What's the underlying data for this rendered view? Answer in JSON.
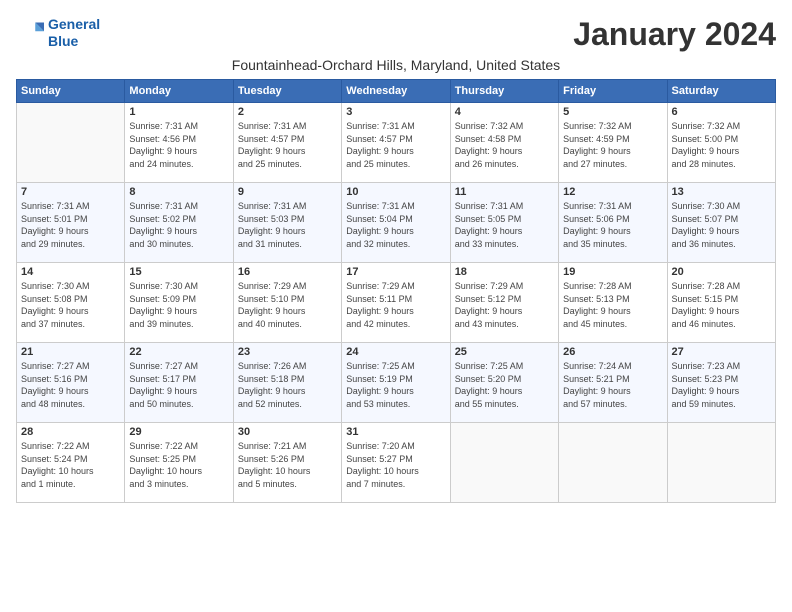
{
  "logo": {
    "line1": "General",
    "line2": "Blue"
  },
  "title": "January 2024",
  "location": "Fountainhead-Orchard Hills, Maryland, United States",
  "days_of_week": [
    "Sunday",
    "Monday",
    "Tuesday",
    "Wednesday",
    "Thursday",
    "Friday",
    "Saturday"
  ],
  "weeks": [
    [
      {
        "day": "",
        "info": ""
      },
      {
        "day": "1",
        "info": "Sunrise: 7:31 AM\nSunset: 4:56 PM\nDaylight: 9 hours\nand 24 minutes."
      },
      {
        "day": "2",
        "info": "Sunrise: 7:31 AM\nSunset: 4:57 PM\nDaylight: 9 hours\nand 25 minutes."
      },
      {
        "day": "3",
        "info": "Sunrise: 7:31 AM\nSunset: 4:57 PM\nDaylight: 9 hours\nand 25 minutes."
      },
      {
        "day": "4",
        "info": "Sunrise: 7:32 AM\nSunset: 4:58 PM\nDaylight: 9 hours\nand 26 minutes."
      },
      {
        "day": "5",
        "info": "Sunrise: 7:32 AM\nSunset: 4:59 PM\nDaylight: 9 hours\nand 27 minutes."
      },
      {
        "day": "6",
        "info": "Sunrise: 7:32 AM\nSunset: 5:00 PM\nDaylight: 9 hours\nand 28 minutes."
      }
    ],
    [
      {
        "day": "7",
        "info": "Sunrise: 7:31 AM\nSunset: 5:01 PM\nDaylight: 9 hours\nand 29 minutes."
      },
      {
        "day": "8",
        "info": "Sunrise: 7:31 AM\nSunset: 5:02 PM\nDaylight: 9 hours\nand 30 minutes."
      },
      {
        "day": "9",
        "info": "Sunrise: 7:31 AM\nSunset: 5:03 PM\nDaylight: 9 hours\nand 31 minutes."
      },
      {
        "day": "10",
        "info": "Sunrise: 7:31 AM\nSunset: 5:04 PM\nDaylight: 9 hours\nand 32 minutes."
      },
      {
        "day": "11",
        "info": "Sunrise: 7:31 AM\nSunset: 5:05 PM\nDaylight: 9 hours\nand 33 minutes."
      },
      {
        "day": "12",
        "info": "Sunrise: 7:31 AM\nSunset: 5:06 PM\nDaylight: 9 hours\nand 35 minutes."
      },
      {
        "day": "13",
        "info": "Sunrise: 7:30 AM\nSunset: 5:07 PM\nDaylight: 9 hours\nand 36 minutes."
      }
    ],
    [
      {
        "day": "14",
        "info": "Sunrise: 7:30 AM\nSunset: 5:08 PM\nDaylight: 9 hours\nand 37 minutes."
      },
      {
        "day": "15",
        "info": "Sunrise: 7:30 AM\nSunset: 5:09 PM\nDaylight: 9 hours\nand 39 minutes."
      },
      {
        "day": "16",
        "info": "Sunrise: 7:29 AM\nSunset: 5:10 PM\nDaylight: 9 hours\nand 40 minutes."
      },
      {
        "day": "17",
        "info": "Sunrise: 7:29 AM\nSunset: 5:11 PM\nDaylight: 9 hours\nand 42 minutes."
      },
      {
        "day": "18",
        "info": "Sunrise: 7:29 AM\nSunset: 5:12 PM\nDaylight: 9 hours\nand 43 minutes."
      },
      {
        "day": "19",
        "info": "Sunrise: 7:28 AM\nSunset: 5:13 PM\nDaylight: 9 hours\nand 45 minutes."
      },
      {
        "day": "20",
        "info": "Sunrise: 7:28 AM\nSunset: 5:15 PM\nDaylight: 9 hours\nand 46 minutes."
      }
    ],
    [
      {
        "day": "21",
        "info": "Sunrise: 7:27 AM\nSunset: 5:16 PM\nDaylight: 9 hours\nand 48 minutes."
      },
      {
        "day": "22",
        "info": "Sunrise: 7:27 AM\nSunset: 5:17 PM\nDaylight: 9 hours\nand 50 minutes."
      },
      {
        "day": "23",
        "info": "Sunrise: 7:26 AM\nSunset: 5:18 PM\nDaylight: 9 hours\nand 52 minutes."
      },
      {
        "day": "24",
        "info": "Sunrise: 7:25 AM\nSunset: 5:19 PM\nDaylight: 9 hours\nand 53 minutes."
      },
      {
        "day": "25",
        "info": "Sunrise: 7:25 AM\nSunset: 5:20 PM\nDaylight: 9 hours\nand 55 minutes."
      },
      {
        "day": "26",
        "info": "Sunrise: 7:24 AM\nSunset: 5:21 PM\nDaylight: 9 hours\nand 57 minutes."
      },
      {
        "day": "27",
        "info": "Sunrise: 7:23 AM\nSunset: 5:23 PM\nDaylight: 9 hours\nand 59 minutes."
      }
    ],
    [
      {
        "day": "28",
        "info": "Sunrise: 7:22 AM\nSunset: 5:24 PM\nDaylight: 10 hours\nand 1 minute."
      },
      {
        "day": "29",
        "info": "Sunrise: 7:22 AM\nSunset: 5:25 PM\nDaylight: 10 hours\nand 3 minutes."
      },
      {
        "day": "30",
        "info": "Sunrise: 7:21 AM\nSunset: 5:26 PM\nDaylight: 10 hours\nand 5 minutes."
      },
      {
        "day": "31",
        "info": "Sunrise: 7:20 AM\nSunset: 5:27 PM\nDaylight: 10 hours\nand 7 minutes."
      },
      {
        "day": "",
        "info": ""
      },
      {
        "day": "",
        "info": ""
      },
      {
        "day": "",
        "info": ""
      }
    ]
  ]
}
